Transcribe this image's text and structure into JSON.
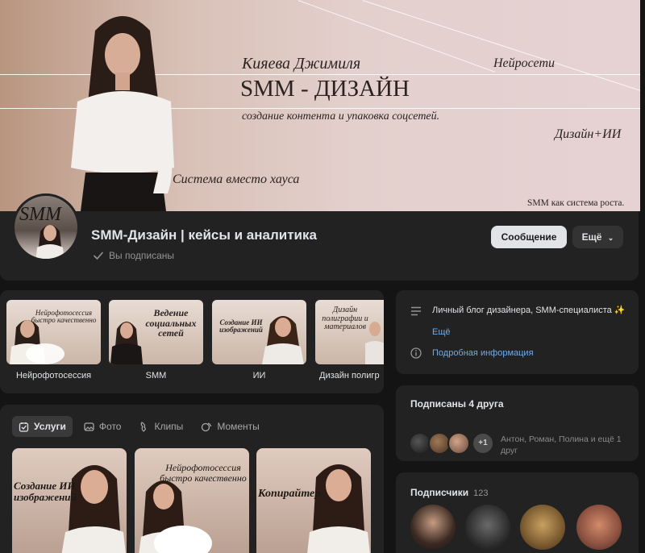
{
  "cover": {
    "name": "Кияева Джимиля",
    "headline": "SMM - ДИЗАЙН",
    "tagline": "создание контента и упаковка соцсетей.",
    "tag_ai": "Нейросети",
    "tag_design": "Дизайн+ИИ",
    "slogan": "Система вместо хауса",
    "footer": "SMM как система роста.",
    "bg_color": "#e3cfcc"
  },
  "header": {
    "avatar_text": "SMM",
    "title": "SMM-Дизайн | кейсы и аналитика",
    "subscribed_label": "Вы подписаны",
    "message_button": "Сообщение",
    "more_button": "Ещё",
    "icons": {
      "subscribed": "check-icon",
      "more": "chevron-down-icon"
    }
  },
  "albums": [
    {
      "label": "Нейрофотосессия",
      "cover_text": "Нейрофотосессия быстро качественно"
    },
    {
      "label": "SMM",
      "cover_text": "Ведение социальных сетей"
    },
    {
      "label": "ИИ",
      "cover_text": "Создание ИИ изображений"
    },
    {
      "label": "Дизайн полигр",
      "cover_text": "Дизайн полиграфии и материалов"
    }
  ],
  "services": {
    "tabs": [
      {
        "label": "Услуги",
        "icon": "services-icon",
        "active": true
      },
      {
        "label": "Фото",
        "icon": "photo-icon",
        "active": false
      },
      {
        "label": "Клипы",
        "icon": "clips-icon",
        "active": false
      },
      {
        "label": "Моменты",
        "icon": "moments-icon",
        "active": false
      }
    ],
    "cards": [
      {
        "text": "Создание ИИ изображений"
      },
      {
        "text": "Нейрофотосессия быстро качественно"
      },
      {
        "text": "Копирайтер"
      }
    ]
  },
  "info": {
    "description": "Личный блог дизайнера, SMM-специалиста ✨",
    "more_link": "Ещё",
    "details_link": "Подробная информация",
    "icons": {
      "description": "text-lines-icon",
      "details": "info-icon"
    }
  },
  "friends": {
    "title": "Подписаны 4 друга",
    "plus_label": "+1",
    "names": "Антон, Роман, Полина и ещё 1 друг"
  },
  "followers": {
    "title": "Подписчики",
    "count": "123"
  },
  "colors": {
    "page_bg": "#141414",
    "panel_bg": "#222222",
    "text": "#e1e3e6",
    "muted": "#939393",
    "link": "#71aaeb",
    "button_light": "#e1e3e6"
  }
}
